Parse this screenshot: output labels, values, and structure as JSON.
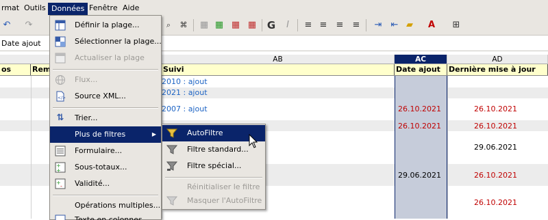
{
  "menubar": {
    "items": [
      {
        "label": "rmat"
      },
      {
        "label": "Outils"
      },
      {
        "label": "Données"
      },
      {
        "label": "Fenêtre"
      },
      {
        "label": "Aide"
      }
    ]
  },
  "namebox": {
    "value": "Date ajout"
  },
  "columns": {
    "ab": "AB",
    "ac": "AC",
    "ad": "AD"
  },
  "header_row": {
    "c1": "os",
    "c2": "Rem",
    "ab": "Suivi",
    "ac": "Date ajout",
    "ad": "Dernière mise à jour"
  },
  "rows": [
    {
      "ab": "2010 : ajout",
      "ac": "",
      "ad": ""
    },
    {
      "ab": "2021 : ajout",
      "ac": "",
      "ad": ""
    },
    {
      "ab": "2007 : ajout",
      "ac": "",
      "ad": ""
    },
    {
      "ab": "",
      "ac": "26.10.2021",
      "ad": "26.10.2021"
    },
    {
      "ab": "",
      "ac": "26.10.2021",
      "ad": "26.10.2021"
    },
    {
      "ab": "",
      "ac": "",
      "ad": "29.06.2021"
    },
    {
      "ab": "",
      "ac": "29.06.2021",
      "ad": "26.10.2021"
    },
    {
      "ab": "",
      "ac": "",
      "ad": "26.10.2021"
    }
  ],
  "menu": {
    "items": [
      {
        "label": "Définir la plage...",
        "icon": "define-range-icon"
      },
      {
        "label": "Sélectionner la plage...",
        "icon": "select-range-icon"
      },
      {
        "label": "Actualiser la plage",
        "icon": "refresh-range-icon"
      },
      {
        "label": "Flux...",
        "icon": "globe-icon"
      },
      {
        "label": "Source XML...",
        "icon": "xml-source-icon"
      },
      {
        "label": "Trier...",
        "icon": "sort-icon"
      },
      {
        "label": "Plus de filtres",
        "icon": "arrow-right-icon"
      },
      {
        "label": "Formulaire...",
        "icon": "form-icon"
      },
      {
        "label": "Sous-totaux...",
        "icon": "subtotals-icon"
      },
      {
        "label": "Validité...",
        "icon": "validity-icon"
      },
      {
        "label": "Opérations multiples...",
        "icon": ""
      },
      {
        "label": "Texte en colonnes...",
        "icon": "text-to-columns-icon"
      }
    ]
  },
  "submenu": {
    "items": [
      {
        "label": "AutoFiltre",
        "icon": "autofilter-icon"
      },
      {
        "label": "Filtre standard...",
        "icon": "standard-filter-icon"
      },
      {
        "label": "Filtre spécial...",
        "icon": "advanced-filter-icon"
      },
      {
        "label": "Réinitialiser le filtre",
        "icon": "reset-filter-icon"
      },
      {
        "label": "Masquer l'AutoFiltre",
        "icon": "hide-autofilter-icon"
      }
    ]
  },
  "colors": {
    "accent": "#0a246a",
    "date_red": "#c00000",
    "link_blue": "#1c63c4",
    "header_fill": "#ffffcc",
    "selected_column": "#c6ccda"
  }
}
